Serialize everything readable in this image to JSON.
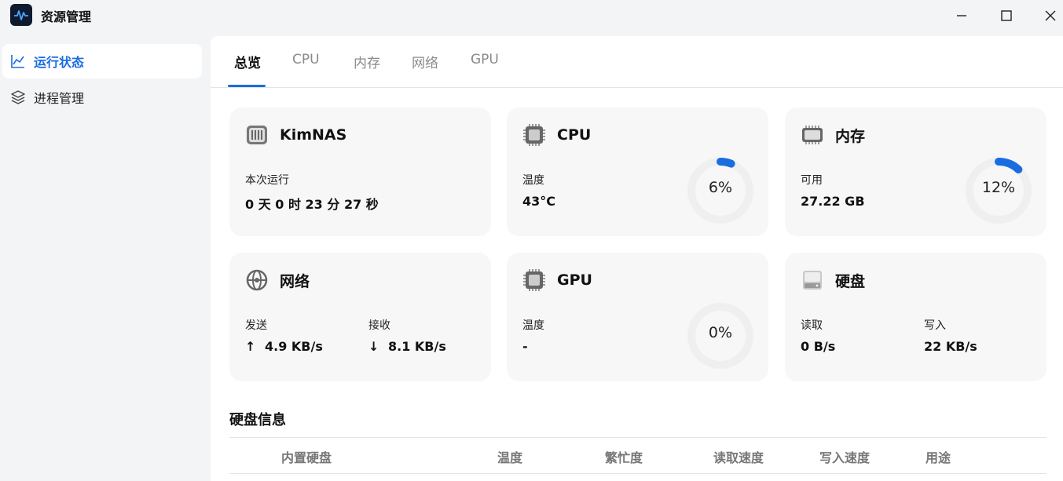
{
  "window": {
    "title": "资源管理",
    "controls": [
      "minimize-icon",
      "maximize-icon",
      "close-icon"
    ]
  },
  "sidebar": {
    "items": [
      {
        "label": "运行状态",
        "icon": "line-chart-icon",
        "active": true
      },
      {
        "label": "进程管理",
        "icon": "layers-icon",
        "active": false
      }
    ]
  },
  "tabs": [
    {
      "label": "总览",
      "active": true
    },
    {
      "label": "CPU",
      "active": false
    },
    {
      "label": "内存",
      "active": false
    },
    {
      "label": "网络",
      "active": false
    },
    {
      "label": "GPU",
      "active": false
    }
  ],
  "cards": {
    "system": {
      "title": "KimNAS",
      "icon": "server-icon",
      "uptime_label": "本次运行",
      "uptime_value": "0 天 0 时 23 分 27 秒"
    },
    "cpu": {
      "title": "CPU",
      "icon": "cpu-chip-icon",
      "temp_label": "温度",
      "temp_value": "43°C",
      "usage_text": "6%",
      "usage": 6
    },
    "memory": {
      "title": "内存",
      "icon": "ram-icon",
      "avail_label": "可用",
      "avail_value": "27.22 GB",
      "usage_text": "12%",
      "usage": 12
    },
    "network": {
      "title": "网络",
      "icon": "network-globe-icon",
      "send_label": "发送",
      "send_value": "4.9 KB/s",
      "recv_label": "接收",
      "recv_value": "8.1 KB/s",
      "send_arrow": "↑",
      "recv_arrow": "↓"
    },
    "gpu": {
      "title": "GPU",
      "icon": "gpu-chip-icon",
      "temp_label": "温度",
      "temp_value": "-",
      "usage_text": "0%",
      "usage": 0
    },
    "disk": {
      "title": "硬盘",
      "icon": "hard-disk-icon",
      "read_label": "读取",
      "read_value": "0 B/s",
      "write_label": "写入",
      "write_value": "22 KB/s"
    }
  },
  "disk_info": {
    "title": "硬盘信息",
    "columns": [
      "内置硬盘",
      "温度",
      "繁忙度",
      "读取速度",
      "写入速度",
      "用途"
    ]
  },
  "colors": {
    "accent": "#1a6de0",
    "gauge_track": "#efefef",
    "card_bg": "#f7f7f8"
  }
}
